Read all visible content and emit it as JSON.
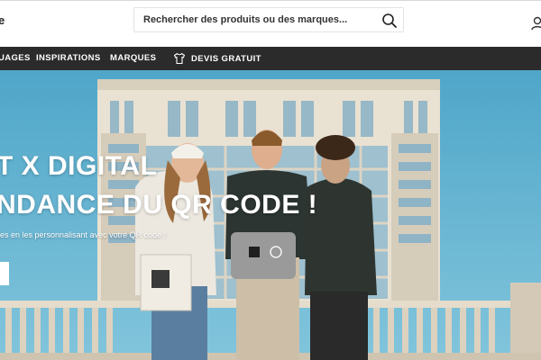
{
  "header": {
    "logo_fragment": "e",
    "search": {
      "placeholder": "Rechercher des produits ou des marques..."
    }
  },
  "nav": {
    "items": [
      {
        "label": "UAGES"
      },
      {
        "label": "INSPIRATIONS"
      },
      {
        "label": "MARQUES"
      }
    ],
    "devis_label": "DEVIS GRATUIT"
  },
  "hero": {
    "title_line1": "T X DIGITAL",
    "title_line2": "NDANCE DU QR CODE !",
    "subtitle": "les en les personnalisant avec votre QR code !"
  },
  "colors": {
    "nav_bg": "#2b2b2b",
    "sky": "#5fb3d1",
    "text_light": "#ffffff"
  }
}
